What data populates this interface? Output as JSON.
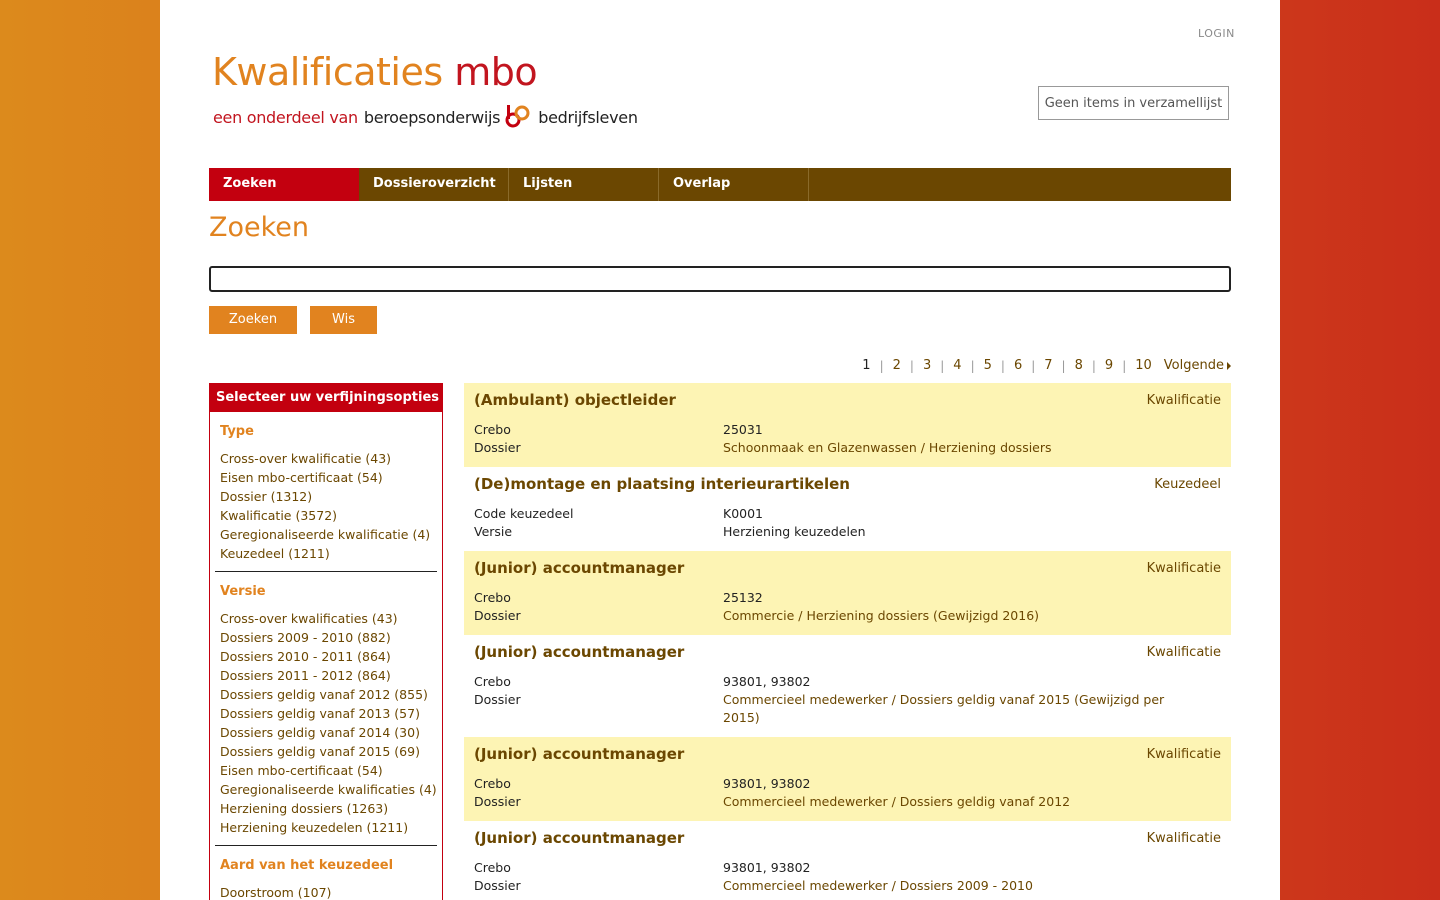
{
  "header": {
    "login": "LOGIN",
    "logo_title_part1": "Kwalificaties",
    "logo_title_part2": " mbo",
    "logo_sub_1": "een onderdeel van",
    "logo_sub_2": "beroepsonderwijs",
    "logo_sub_3": "bedrijfsleven",
    "collection": "Geen items in verzamellijst"
  },
  "nav": {
    "items": [
      "Zoeken",
      "Dossieroverzicht",
      "Lijsten",
      "Overlap"
    ]
  },
  "page_title": "Zoeken",
  "search": {
    "value": "",
    "button_search": "Zoeken",
    "button_clear": "Wis"
  },
  "pager": {
    "pages": [
      "1",
      "2",
      "3",
      "4",
      "5",
      "6",
      "7",
      "8",
      "9",
      "10"
    ],
    "current": "1",
    "next": "Volgende"
  },
  "sidebar": {
    "title": "Selecteer uw verfijningsopties",
    "facets": [
      {
        "title": "Type",
        "items": [
          "Cross-over kwalificatie (43)",
          "Eisen mbo-certificaat (54)",
          "Dossier (1312)",
          "Kwalificatie (3572)",
          "Geregionaliseerde kwalificatie (4)",
          "Keuzedeel (1211)"
        ]
      },
      {
        "title": "Versie",
        "items": [
          "Cross-over kwalificaties (43)",
          "Dossiers 2009 - 2010 (882)",
          "Dossiers 2010 - 2011 (864)",
          "Dossiers 2011 - 2012 (864)",
          "Dossiers geldig vanaf 2012 (855)",
          "Dossiers geldig vanaf 2013 (57)",
          "Dossiers geldig vanaf 2014 (30)",
          "Dossiers geldig vanaf 2015 (69)",
          "Eisen mbo-certificaat (54)",
          "Geregionaliseerde kwalificaties (4)",
          "Herziening dossiers (1263)",
          "Herziening keuzedelen (1211)"
        ]
      },
      {
        "title": "Aard van het keuzedeel",
        "items": [
          "Doorstroom (107)"
        ]
      }
    ]
  },
  "results": [
    {
      "title": "(Ambulant) objectleider",
      "type": "Kwalificatie",
      "highlight": true,
      "rows": [
        {
          "label": "Crebo",
          "value": "25031",
          "link": false
        },
        {
          "label": "Dossier",
          "value": "Schoonmaak en Glazenwassen / Herziening dossiers",
          "link": true
        }
      ]
    },
    {
      "title": "(De)montage en plaatsing interieurartikelen",
      "type": "Keuzedeel",
      "highlight": false,
      "rows": [
        {
          "label": "Code keuzedeel",
          "value": "K0001",
          "link": false
        },
        {
          "label": "Versie",
          "value": "Herziening keuzedelen",
          "link": false
        }
      ]
    },
    {
      "title": "(Junior) accountmanager",
      "type": "Kwalificatie",
      "highlight": true,
      "rows": [
        {
          "label": "Crebo",
          "value": "25132",
          "link": false
        },
        {
          "label": "Dossier",
          "value": "Commercie / Herziening dossiers (Gewijzigd 2016)",
          "link": true
        }
      ]
    },
    {
      "title": "(Junior) accountmanager",
      "type": "Kwalificatie",
      "highlight": false,
      "rows": [
        {
          "label": "Crebo",
          "value": "93801, 93802",
          "link": false
        },
        {
          "label": "Dossier",
          "value": "Commercieel medewerker / Dossiers geldig vanaf 2015 (Gewijzigd per 2015)",
          "link": true
        }
      ]
    },
    {
      "title": "(Junior) accountmanager",
      "type": "Kwalificatie",
      "highlight": true,
      "rows": [
        {
          "label": "Crebo",
          "value": "93801, 93802",
          "link": false
        },
        {
          "label": "Dossier",
          "value": "Commercieel medewerker / Dossiers geldig vanaf 2012",
          "link": true
        }
      ]
    },
    {
      "title": "(Junior) accountmanager",
      "type": "Kwalificatie",
      "highlight": false,
      "rows": [
        {
          "label": "Crebo",
          "value": "93801, 93802",
          "link": false
        },
        {
          "label": "Dossier",
          "value": "Commercieel medewerker / Dossiers 2009 - 2010",
          "link": true
        }
      ]
    }
  ],
  "colors": {
    "brand_red": "#c3000f",
    "brand_orange": "#e1831f",
    "nav_brown": "#6b4701",
    "highlight_yellow": "#fdf4b4"
  }
}
